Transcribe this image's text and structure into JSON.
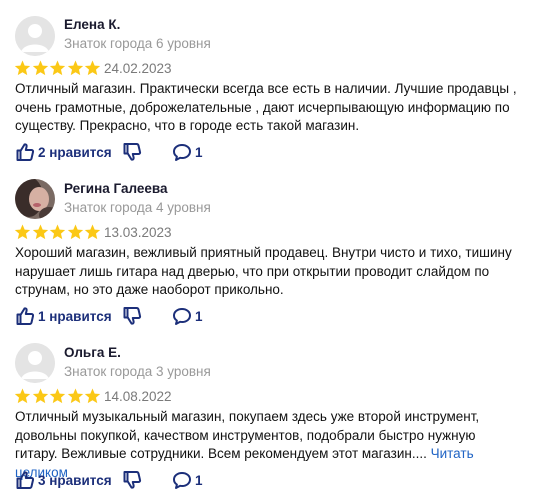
{
  "reviews": [
    {
      "name": "Елена К.",
      "level": "Знаток города 6 уровня",
      "stars": 5,
      "date": "24.02.2023",
      "text": "Отличный магазин. Практически всегда все есть в наличии. Лучшие продавцы , очень грамотные, доброжелательные , дают исчерпывающую информацию по существу. Прекрасно, что в городе есть такой магазин.",
      "more": "",
      "likes_label": "2 нравится",
      "comments": "1",
      "avatar": "placeholder-avatar-icon"
    },
    {
      "name": "Регина Галеева",
      "level": "Знаток города 4 уровня",
      "stars": 5,
      "date": "13.03.2023",
      "text": "Хороший магазин, вежливый приятный продавец. Внутри чисто и тихо, тишину нарушает лишь гитара над дверью, что при открытии проводит слайдом по струнам, но это даже наоборот прикольно.",
      "more": "",
      "likes_label": "1 нравится",
      "comments": "1",
      "avatar": "user-photo"
    },
    {
      "name": "Ольга Е.",
      "level": "Знаток города 3 уровня",
      "stars": 5,
      "date": "14.08.2022",
      "text": "Отличный музыкальный магазин, покупаем здесь уже второй инструмент, довольны покупкой, качеством инструментов, подобрали быстро нужную гитару. Вежливые сотрудники. Всем рекомендуем этот магазин.... ",
      "more": "Читать целиком",
      "likes_label": "3 нравится",
      "comments": "1",
      "avatar": "placeholder-avatar-icon"
    }
  ],
  "colors": {
    "star": "#fbc816",
    "action": "#1c2f7a",
    "link": "#1f63c4",
    "muted": "#999999"
  }
}
